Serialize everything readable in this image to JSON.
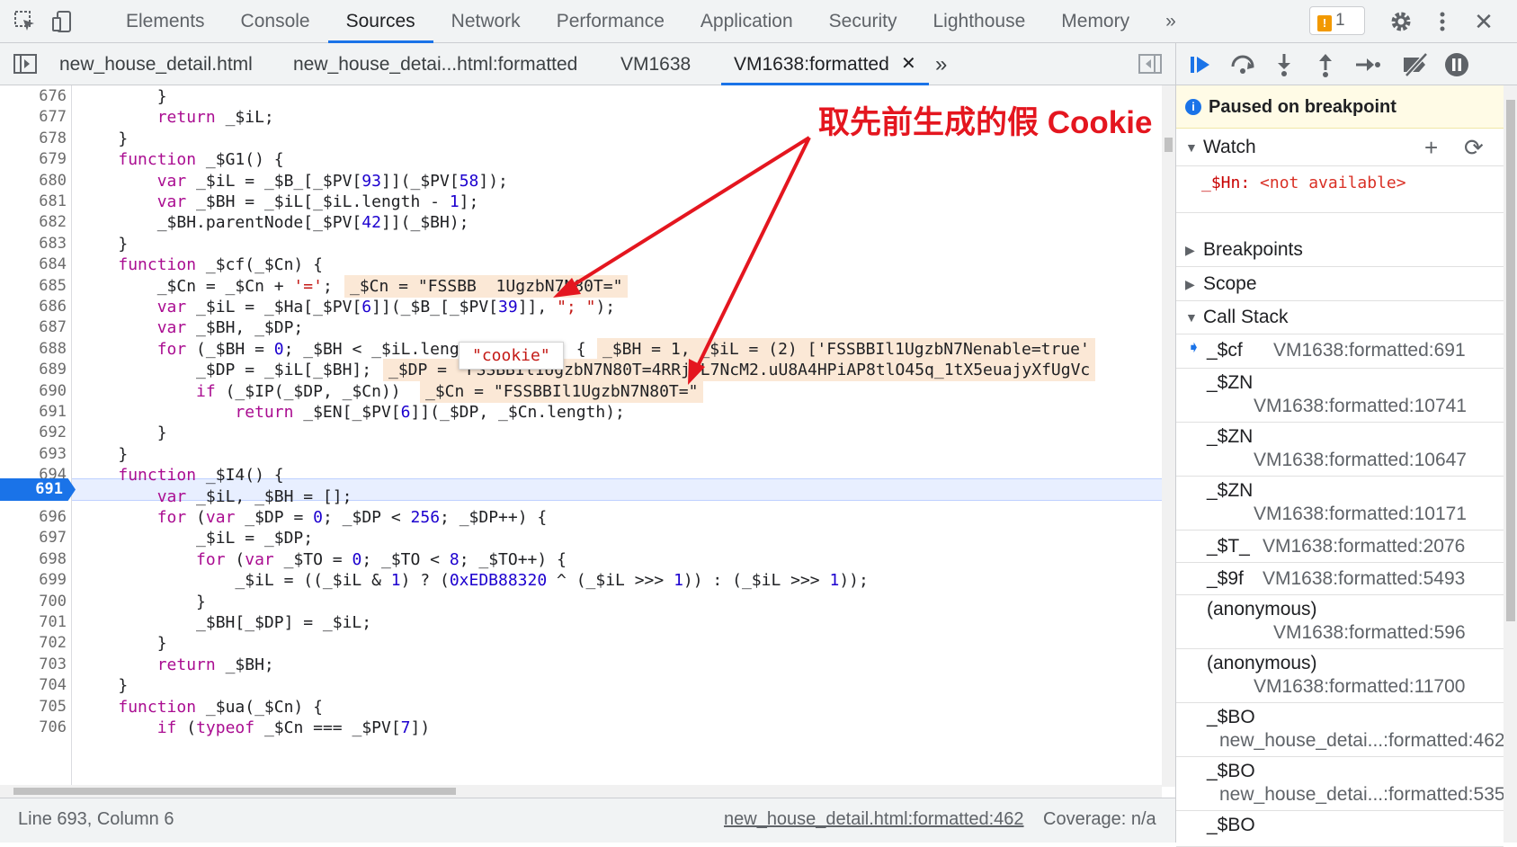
{
  "toolbar": {
    "tabs": [
      "Elements",
      "Console",
      "Sources",
      "Network",
      "Performance",
      "Application",
      "Security",
      "Lighthouse",
      "Memory"
    ],
    "active_tab": "Sources",
    "more": "»",
    "issues_count": "1",
    "close": "✕"
  },
  "files": {
    "tabs": [
      "new_house_detail.html",
      "new_house_detai...html:formatted",
      "VM1638",
      "VM1638:formatted"
    ],
    "active": "VM1638:formatted",
    "close": "✕",
    "more": "»"
  },
  "code": {
    "lines": [
      {
        "n": "676",
        "t": "        }"
      },
      {
        "n": "677",
        "t": "        return _$iL;"
      },
      {
        "n": "678",
        "t": "    }"
      },
      {
        "n": "679",
        "t": "    function _$G1() {"
      },
      {
        "n": "680",
        "t": "        var _$iL = _$B_[_$PV[93]](_$PV[58]);"
      },
      {
        "n": "681",
        "t": "        var _$BH = _$iL[_$iL.length - 1];"
      },
      {
        "n": "682",
        "t": "        _$BH.parentNode[_$PV[42]](_$BH);"
      },
      {
        "n": "683",
        "t": "    }"
      },
      {
        "n": "684",
        "t": "    function _$cf(_$Cn) {"
      },
      {
        "n": "685",
        "t": "        _$Cn = _$Cn + '=';"
      },
      {
        "n": "686",
        "t": "        var _$iL = _$Ha[_$PV[6]](_$B_[_$PV[39]], \"; \");"
      },
      {
        "n": "687",
        "t": "        var _$BH, _$DP;"
      },
      {
        "n": "688",
        "t": "        for (_$BH = 0; _$BH < _$iL.length; _$BH++) {"
      },
      {
        "n": "689",
        "t": "            _$DP = _$iL[_$BH];"
      },
      {
        "n": "690",
        "t": "            if (_$IP(_$DP, _$Cn))"
      },
      {
        "n": "691",
        "t": "                return _$EN[_$PV[6]](_$DP, _$Cn.length);"
      },
      {
        "n": "692",
        "t": "        }"
      },
      {
        "n": "693",
        "t": "    }"
      },
      {
        "n": "694",
        "t": "    function _$I4() {"
      },
      {
        "n": "695",
        "t": "        var _$iL, _$BH = [];"
      },
      {
        "n": "696",
        "t": "        for (var _$DP = 0; _$DP < 256; _$DP++) {"
      },
      {
        "n": "697",
        "t": "            _$iL = _$DP;"
      },
      {
        "n": "698",
        "t": "            for (var _$TO = 0; _$TO < 8; _$TO++) {"
      },
      {
        "n": "699",
        "t": "                _$iL = ((_$iL & 1) ? (0xEDB88320 ^ (_$iL >>> 1)) : (_$iL >>> 1));"
      },
      {
        "n": "700",
        "t": "            }"
      },
      {
        "n": "701",
        "t": "            _$BH[_$DP] = _$iL;"
      },
      {
        "n": "702",
        "t": "        }"
      },
      {
        "n": "703",
        "t": "        return _$BH;"
      },
      {
        "n": "704",
        "t": "    }"
      },
      {
        "n": "705",
        "t": "    function _$ua(_$Cn) {"
      },
      {
        "n": "706",
        "t": "        if (typeof _$Cn === _$PV[7])"
      }
    ],
    "inline_values": {
      "l685": "_$Cn = \"FSSBB  1UgzbN7N80T=\"",
      "l688": "_$BH = 1, _$iL = (2) ['FSSBBIl1UgzbN7Nenable=true'",
      "l689": "_$DP = \"FSSBBIl1UgzbN7N80T=4RRjDL7NcM2.uU8A4HPiAP8tlO45q_1tX5euajyXfUgVc",
      "l690": "_$Cn = \"FSSBBIl1UgzbN7N80T=\""
    },
    "current_line": "691",
    "tooltip": "\"cookie\""
  },
  "annotation": "取先前生成的假 Cookie",
  "status": {
    "position": "Line 693, Column 6",
    "source": "new_house_detail.html:formatted:462",
    "coverage": "Coverage: n/a"
  },
  "debugger": {
    "paused": "Paused on breakpoint",
    "watch": "Watch",
    "watch_name": "_$Hn:",
    "watch_value": "<not available>",
    "breakpoints": "Breakpoints",
    "scope": "Scope",
    "call_stack": "Call Stack",
    "frames": [
      {
        "fn": "_$cf",
        "loc": "VM1638:formatted:691"
      },
      {
        "fn": "_$ZN",
        "loc": "VM1638:formatted:10741"
      },
      {
        "fn": "_$ZN",
        "loc": "VM1638:formatted:10647"
      },
      {
        "fn": "_$ZN",
        "loc": "VM1638:formatted:10171"
      },
      {
        "fn": "_$T_",
        "loc": "VM1638:formatted:2076"
      },
      {
        "fn": "_$9f",
        "loc": "VM1638:formatted:5493"
      },
      {
        "fn": "(anonymous)",
        "loc": "VM1638:formatted:596"
      },
      {
        "fn": "(anonymous)",
        "loc": "VM1638:formatted:11700"
      },
      {
        "fn": "_$BO",
        "loc": "new_house_detai...:formatted:462"
      },
      {
        "fn": "_$BO",
        "loc": "new_house_detai...:formatted:535"
      },
      {
        "fn": "_$BO",
        "loc": ""
      }
    ]
  },
  "colors": {
    "accent": "#1a73e8",
    "annotation": "#e4161f",
    "keyword": "#aa0d91",
    "number": "#1c00cf"
  }
}
